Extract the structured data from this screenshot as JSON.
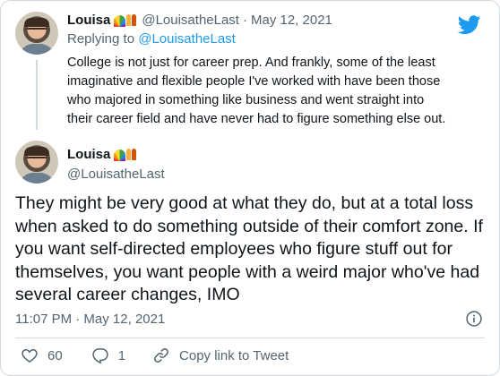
{
  "parent": {
    "name": "Louisa",
    "handle": "@LouisatheLast",
    "separator": "·",
    "date": "May 12, 2021",
    "replying_prefix": "Replying to",
    "replying_to": "@LouisatheLast",
    "text": "College is not just for career prep. And frankly, some of the least imaginative and flexible people I've worked with have been those who majored in something like business and went straight into their career field and have never had to figure something else out."
  },
  "main": {
    "name": "Louisa",
    "handle": "@LouisatheLast",
    "text": "They might be very good at what they do, but at a total loss when asked to do something outside of their comfort zone. If you want self-directed employees who figure stuff out for themselves, you want people with a weird major who've had several career changes, IMO",
    "timestamp": "11:07 PM · May 12, 2021"
  },
  "actions": {
    "likes": "60",
    "replies": "1",
    "copy_label": "Copy link to Tweet"
  },
  "icons": {
    "brand": "twitter-bird-icon",
    "info": "info-icon",
    "like": "heart-icon",
    "reply": "reply-bubble-icon",
    "copy": "link-icon"
  },
  "colors": {
    "accent": "#1d9bf0",
    "text": "#0f1419",
    "secondary": "#536471",
    "border": "#cfd9de"
  }
}
